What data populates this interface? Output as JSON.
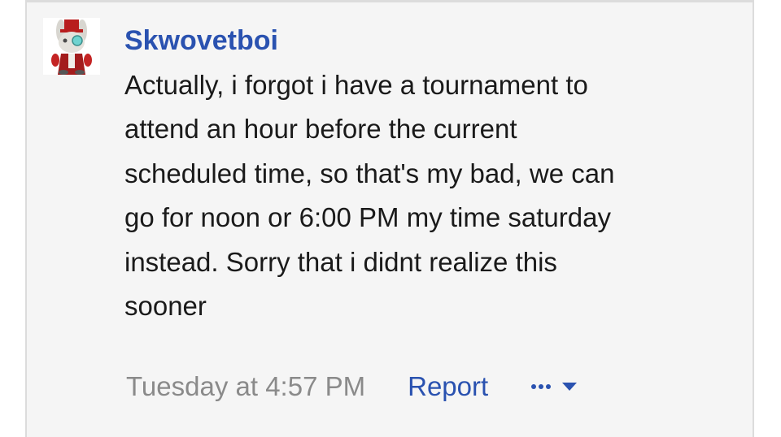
{
  "post": {
    "username": "Skwovetboi",
    "avatar_icon": "bunny-mascot-avatar",
    "message_lines": [
      "Actually, i forgot i have a tournament to",
      "attend an hour before the current",
      "scheduled time, so that's my bad, we can",
      "go for noon or 6:00 PM my time saturday",
      "instead. Sorry that i didnt realize this",
      "sooner"
    ],
    "timestamp": "Tuesday at 4:57 PM",
    "report_label": "Report",
    "more_icon": "more-options-dots-icon",
    "dropdown_icon": "caret-down-icon"
  },
  "colors": {
    "username": "#2a52b0",
    "link": "#2a52b0",
    "timestamp": "#8a8a8a",
    "card_background": "#f5f5f5"
  }
}
